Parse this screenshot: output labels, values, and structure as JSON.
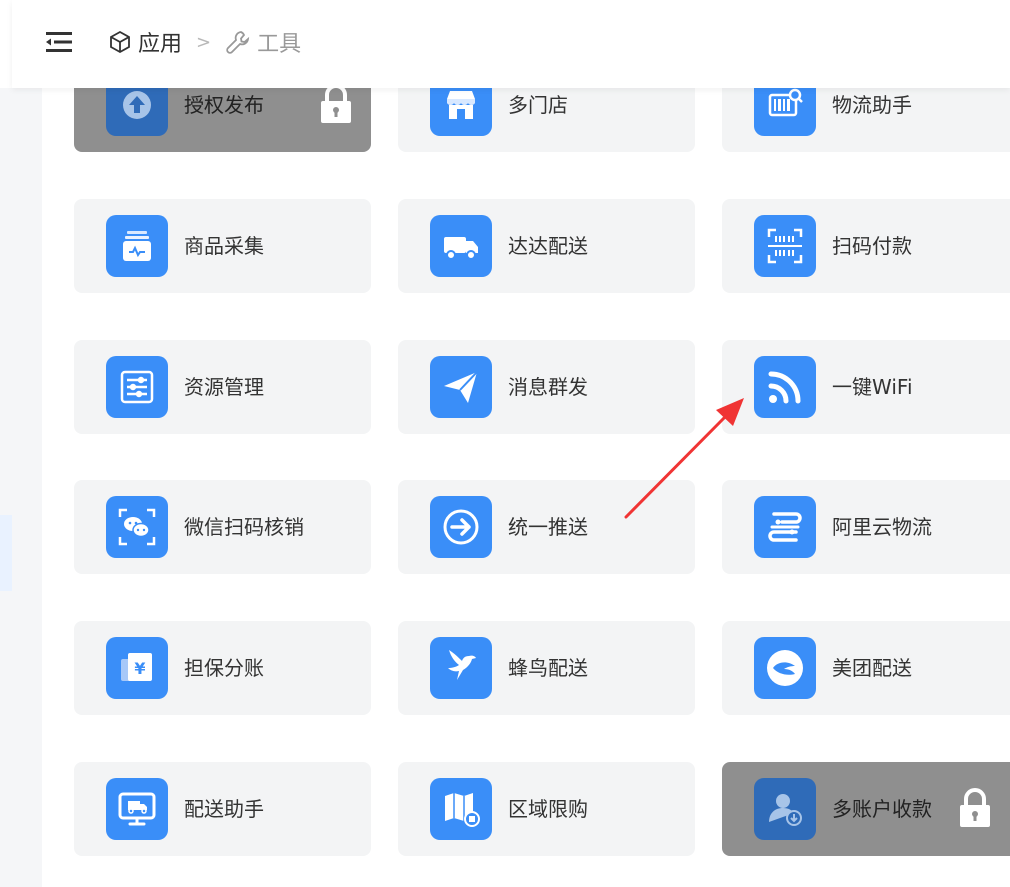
{
  "breadcrumb": {
    "apps": "应用",
    "separator": ">",
    "tools": "工具"
  },
  "cards": [
    {
      "label": "授权发布",
      "icon": "upload-icon",
      "locked": true
    },
    {
      "label": "多门店",
      "icon": "store-icon",
      "locked": false
    },
    {
      "label": "物流助手",
      "icon": "logistics-scan-icon",
      "locked": false
    },
    {
      "label": "商品采集",
      "icon": "collect-box-icon",
      "locked": false
    },
    {
      "label": "达达配送",
      "icon": "truck-icon",
      "locked": false
    },
    {
      "label": "扫码付款",
      "icon": "barcode-scan-icon",
      "locked": false
    },
    {
      "label": "资源管理",
      "icon": "resource-list-icon",
      "locked": false
    },
    {
      "label": "消息群发",
      "icon": "send-plane-icon",
      "locked": false
    },
    {
      "label": "一键WiFi",
      "icon": "wifi-icon",
      "locked": false
    },
    {
      "label": "微信扫码核销",
      "icon": "wechat-scan-icon",
      "locked": false
    },
    {
      "label": "统一推送",
      "icon": "push-arrow-icon",
      "locked": false
    },
    {
      "label": "阿里云物流",
      "icon": "aliyun-logo-icon",
      "locked": false
    },
    {
      "label": "担保分账",
      "icon": "yuan-split-icon",
      "locked": false
    },
    {
      "label": "蜂鸟配送",
      "icon": "hummingbird-icon",
      "locked": false
    },
    {
      "label": "美团配送",
      "icon": "meituan-logo-icon",
      "locked": false
    },
    {
      "label": "配送助手",
      "icon": "delivery-monitor-icon",
      "locked": false
    },
    {
      "label": "区域限购",
      "icon": "region-map-icon",
      "locked": false
    },
    {
      "label": "多账户收款",
      "icon": "multi-account-icon",
      "locked": true
    }
  ],
  "colors": {
    "icon_blue": "#3a8ef8",
    "card_bg": "#f3f4f5",
    "locked_bg": "#8f8f8f",
    "arrow_red": "#f03434"
  }
}
